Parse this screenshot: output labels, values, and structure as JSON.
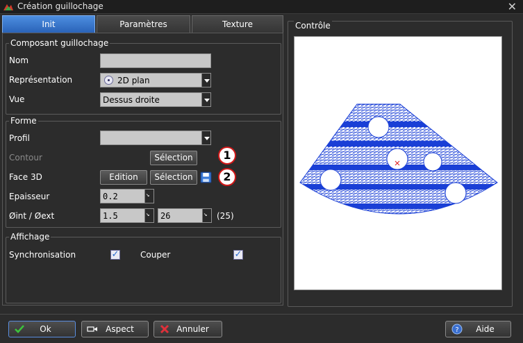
{
  "window": {
    "title": "Création guillochage"
  },
  "tabs": [
    {
      "label": "Init",
      "active": true
    },
    {
      "label": "Paramètres",
      "active": false
    },
    {
      "label": "Texture",
      "active": false
    }
  ],
  "composant": {
    "legend": "Composant guillochage",
    "nom_label": "Nom",
    "nom_value": "",
    "representation_label": "Représentation",
    "representation_value": "2D plan",
    "vue_label": "Vue",
    "vue_value": "Dessus droite"
  },
  "forme": {
    "legend": "Forme",
    "profil_label": "Profil",
    "profil_value": "",
    "contour_label": "Contour",
    "contour_button": "Sélection",
    "face3d_label": "Face 3D",
    "edition_button": "Edition",
    "face3d_selection_button": "Sélection",
    "epaisseur_label": "Epaisseur",
    "epaisseur_value": "0.2",
    "diam_label": "Øint / Øext",
    "int_value": "1.5",
    "ext_value": "26",
    "ext_hint": "(25)",
    "badge1": "1",
    "badge2": "2"
  },
  "affichage": {
    "legend": "Affichage",
    "sync_label": "Synchronisation",
    "sync_checked": true,
    "couper_label": "Couper",
    "couper_checked": true
  },
  "controle": {
    "legend": "Contrôle"
  },
  "buttons": {
    "ok": "Ok",
    "aspect": "Aspect",
    "annuler": "Annuler",
    "aide": "Aide"
  },
  "colors": {
    "accent": "#2a63b8",
    "pattern": "#1a3fd6",
    "badge_border": "#d01818"
  },
  "icons": [
    "app-icon",
    "close-icon",
    "save-icon",
    "check-icon",
    "aspect-icon",
    "cancel-icon",
    "help-icon",
    "center-mark-icon"
  ]
}
